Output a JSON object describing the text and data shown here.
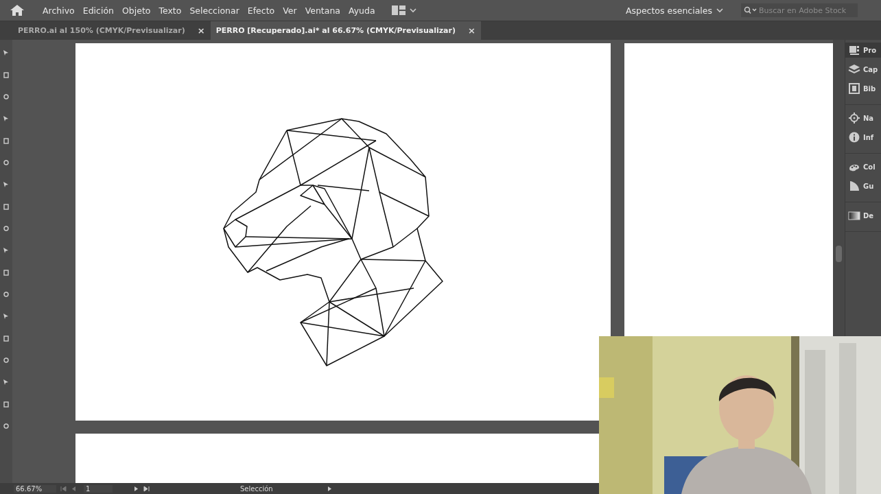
{
  "menu": {
    "items": [
      "Archivo",
      "Edición",
      "Objeto",
      "Texto",
      "Seleccionar",
      "Efecto",
      "Ver",
      "Ventana",
      "Ayuda"
    ],
    "workspace": "Aspectos esenciales",
    "search": {
      "placeholder": "Buscar en Adobe Stock"
    }
  },
  "tabs": [
    {
      "label": "PERRO.ai al 150% (CMYK/Previsualizar)",
      "close": "×",
      "selected": false
    },
    {
      "label": "PERRO [Recuperado].ai* al 66.67% (CMYK/Previsualizar)",
      "close": "×",
      "selected": true
    }
  ],
  "panels": [
    {
      "label": "Pro",
      "kind": "properties",
      "selected": true
    },
    {
      "label": "Cap",
      "kind": "layers",
      "selected": false
    },
    {
      "label": "Bib",
      "kind": "library",
      "selected": false
    },
    {
      "label": "Na",
      "kind": "navigator",
      "selected": false
    },
    {
      "label": "Inf",
      "kind": "info",
      "selected": false
    },
    {
      "label": "Col",
      "kind": "palette",
      "selected": false
    },
    {
      "label": "Gu",
      "kind": "guide",
      "selected": false
    },
    {
      "label": "De",
      "kind": "gradient",
      "selected": false
    }
  ],
  "status_bar": {
    "zoom": "66.67%",
    "artboard": "1",
    "tool": "Selección"
  }
}
